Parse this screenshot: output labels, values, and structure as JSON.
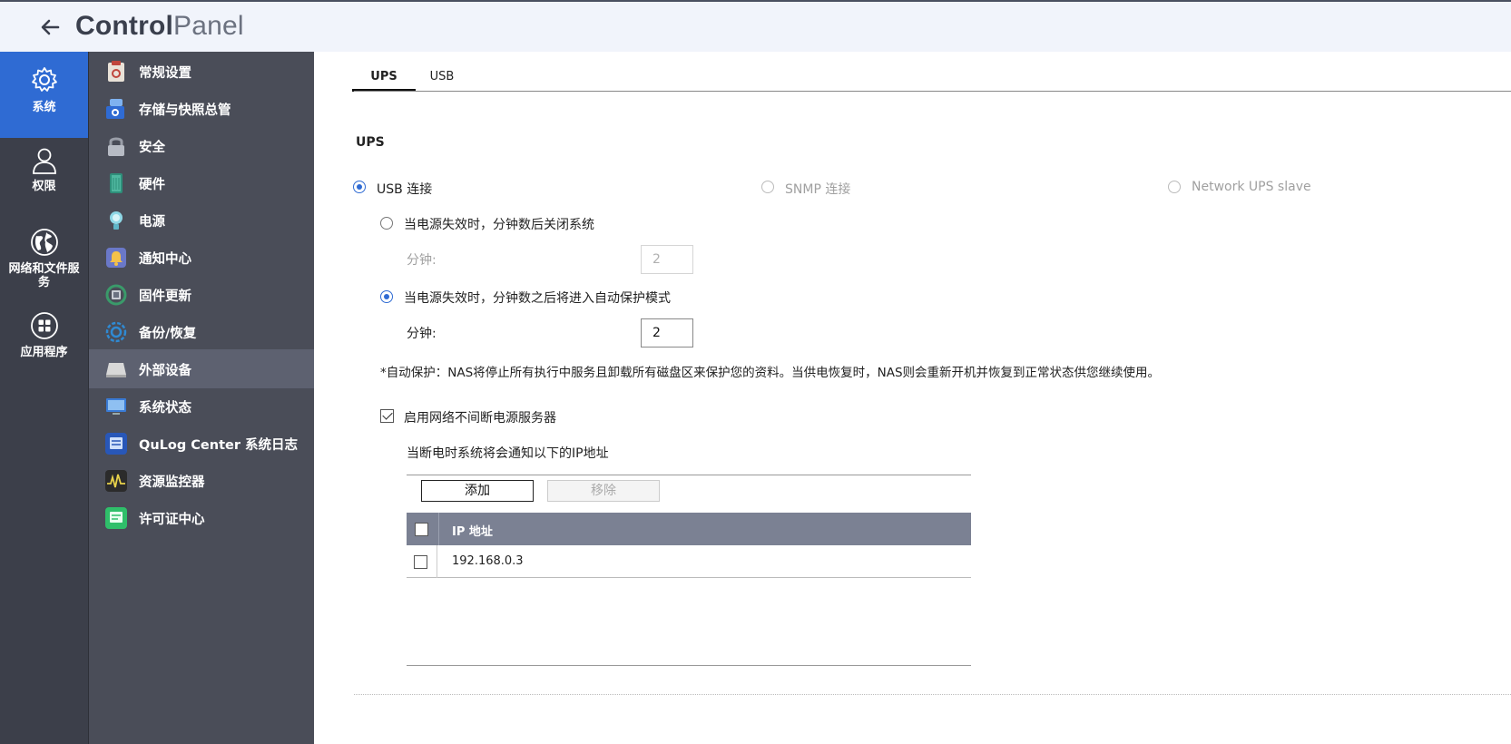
{
  "app": {
    "title_bold": "Control",
    "title_light": "Panel"
  },
  "rail": [
    {
      "label": "系统",
      "icon": "gear-icon",
      "active": true
    },
    {
      "label": "权限",
      "icon": "user-icon",
      "active": false
    },
    {
      "label": "网络和文件服务",
      "icon": "globe-icon",
      "active": false
    },
    {
      "label": "应用程序",
      "icon": "apps-icon",
      "active": false
    }
  ],
  "sidebar": [
    {
      "label": "常规设置",
      "icon": "general-settings-icon",
      "color": "#c0463c"
    },
    {
      "label": "存储与快照总管",
      "icon": "storage-icon",
      "color": "#2f6bd3"
    },
    {
      "label": "安全",
      "icon": "lock-icon",
      "color": "#8a8e99"
    },
    {
      "label": "硬件",
      "icon": "hardware-icon",
      "color": "#2e8f7a"
    },
    {
      "label": "电源",
      "icon": "power-bulb-icon",
      "color": "#5fb6c8"
    },
    {
      "label": "通知中心",
      "icon": "notification-icon",
      "color": "#6a78c8"
    },
    {
      "label": "固件更新",
      "icon": "firmware-icon",
      "color": "#3a9a6a"
    },
    {
      "label": "备份/恢复",
      "icon": "backup-icon",
      "color": "#2f8ad3"
    },
    {
      "label": "外部设备",
      "icon": "external-device-icon",
      "color": "#c9c9c9",
      "active": true
    },
    {
      "label": "系统状态",
      "icon": "monitor-icon",
      "color": "#3a7bd5"
    },
    {
      "label": "QuLog Center 系统日志",
      "icon": "qulog-icon",
      "color": "#2857b8"
    },
    {
      "label": "资源监控器",
      "icon": "resource-monitor-icon",
      "color": "#2b2b2b"
    },
    {
      "label": "许可证中心",
      "icon": "license-icon",
      "color": "#2fbf6a"
    }
  ],
  "tabs": [
    {
      "label": "UPS",
      "active": true
    },
    {
      "label": "USB",
      "active": false
    }
  ],
  "ups": {
    "section_title": "UPS",
    "conn_usb": "USB 连接",
    "conn_snmp": "SNMP 连接",
    "conn_network": "Network UPS slave",
    "opt_shutdown": "当电源失效时，分钟数后关闭系统",
    "minutes_label": "分钟:",
    "shutdown_minutes": "2",
    "opt_protect": "当电源失效时，分钟数之后将进入自动保护模式",
    "protect_minutes": "2",
    "note": "*自动保护：NAS将停止所有执行中服务且卸载所有磁盘区来保护您的资料。当供电恢复时，NAS则会重新开机并恢复到正常状态供您继续使用。",
    "enable_server": "启用网络不间断电源服务器",
    "notify_label": "当断电时系统将会通知以下的IP地址",
    "add_button": "添加",
    "remove_button": "移除",
    "table_header": "IP 地址",
    "ip_rows": [
      "192.168.0.3"
    ]
  }
}
